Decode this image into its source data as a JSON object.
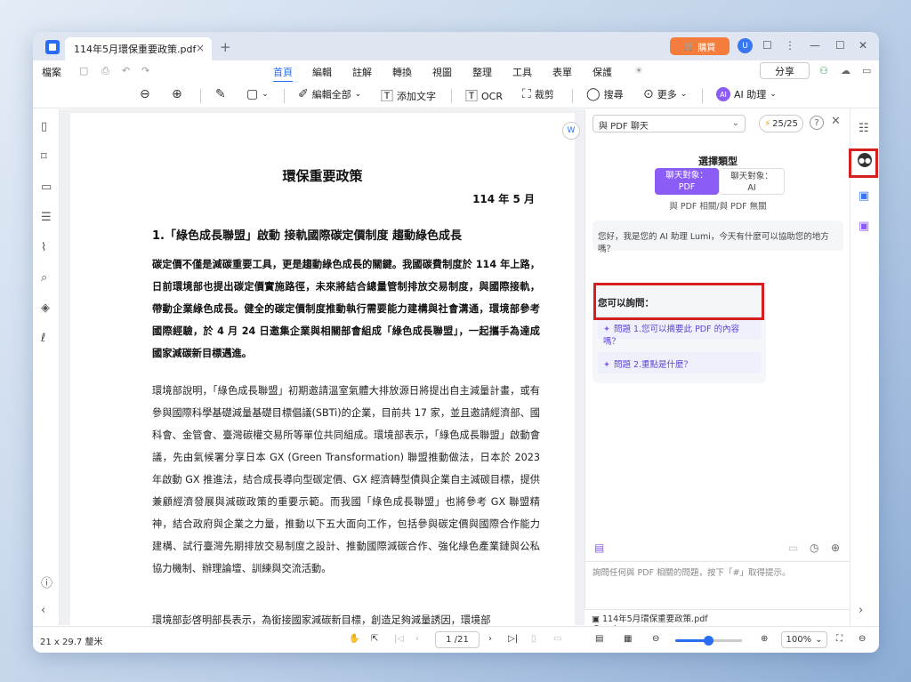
{
  "titlebar": {
    "tab_title": "114年5月環保重要政策.pdf",
    "tab_close": "×",
    "new_tab": "+",
    "buy_label": "購買",
    "window_min": "—",
    "window_max": "☐",
    "window_close": "✕"
  },
  "menubar": {
    "file": "檔案",
    "items": [
      "首頁",
      "編輯",
      "註解",
      "轉換",
      "視圖",
      "整理",
      "工具",
      "表單",
      "保護"
    ],
    "active": "首頁",
    "share": "分享"
  },
  "toolbar": {
    "edit_all": "編輯全部",
    "add_text": "添加文字",
    "ocr": "OCR",
    "crop": "裁剪",
    "search": "搜尋",
    "more": "更多",
    "ai_assistant": "AI 助理"
  },
  "document": {
    "title": "環保重要政策",
    "date": "114 年 5 月",
    "heading": "1.「綠色成長聯盟」啟動 接軌國際碳定價制度 趨動綠色成長",
    "para1": "碳定價不僅是減碳重要工具，更是趨動綠色成長的關鍵。我國碳費制度於 114 年上路，日前環境部也提出碳定價實施路徑，未來將結合總量管制排放交易制度，與國際接軌，帶動企業綠色成長。健全的碳定價制度推動執行需要能力建構與社會溝通，環境部參考國際經驗，於 4 月 24 日邀集企業與相關部會組成「綠色成長聯盟」，一起攜手為達成國家減碳新目標邁進。",
    "para2": "環境部說明，「綠色成長聯盟」初期邀請溫室氣體大排放源日將提出自主減量計畫，或有參與國際科學基礎減量基礎目標倡議(SBTi)的企業，目前共 17 家，並且邀請經濟部、國科會、金管會、臺灣碳權交易所等單位共同組成。環境部表示，「綠色成長聯盟」啟動會議，先由氣候署分享日本 GX (Green Transformation) 聯盟推動做法，日本於 2023 年啟動 GX 推進法，結合成長導向型碳定價、GX 經濟轉型債與企業自主減碳目標，提供兼顧經濟發展與減碳政策的重要示範。而我國「綠色成長聯盟」也將參考 GX 聯盟精神，結合政府與企業之力量，推動以下五大面向工作，包括參與碳定價與國際合作能力建構、試行臺灣先期排放交易制度之設計、推動國際減碳合作、強化綠色產業鏈與公私協力機制、辦理論壇、訓練與交流活動。",
    "para3": "環境部彭啓明部長表示，為銜接國家減碳新目標，創造足夠減量誘因，環境部"
  },
  "chat": {
    "mode_select": "與 PDF 聊天",
    "quota": "25/25",
    "choose_type": "選擇類型",
    "type_pdf_line1": "聊天對象：",
    "type_pdf_line2": "PDF",
    "type_ai_line1": "聊天對象：",
    "type_ai_line2": "AI",
    "type_caption": "與 PDF 相關/與 PDF 無關",
    "greeting": "您好，我是您的 AI 助理 Lumi，今天有什麼可以協助您的地方嗎？",
    "ask_title": "您可以詢問：",
    "question1": "問題 1.您可以摘要此 PDF 的內容嗎？",
    "question2": "問題 2.重點是什麼？",
    "input_placeholder": "詢問任何與 PDF 相關的問題，按下「#」取得提示。",
    "file_name": "114年5月環保重要政策.pdf"
  },
  "statusbar": {
    "page_size": "21 x 29.7 釐米",
    "page_indicator": "1 /21",
    "zoom": "100%"
  },
  "colors": {
    "accent": "#2a6df5",
    "ai_purple": "#8b5cf6",
    "highlight_red": "#d61f1f",
    "buy_orange": "#f47c3c"
  }
}
